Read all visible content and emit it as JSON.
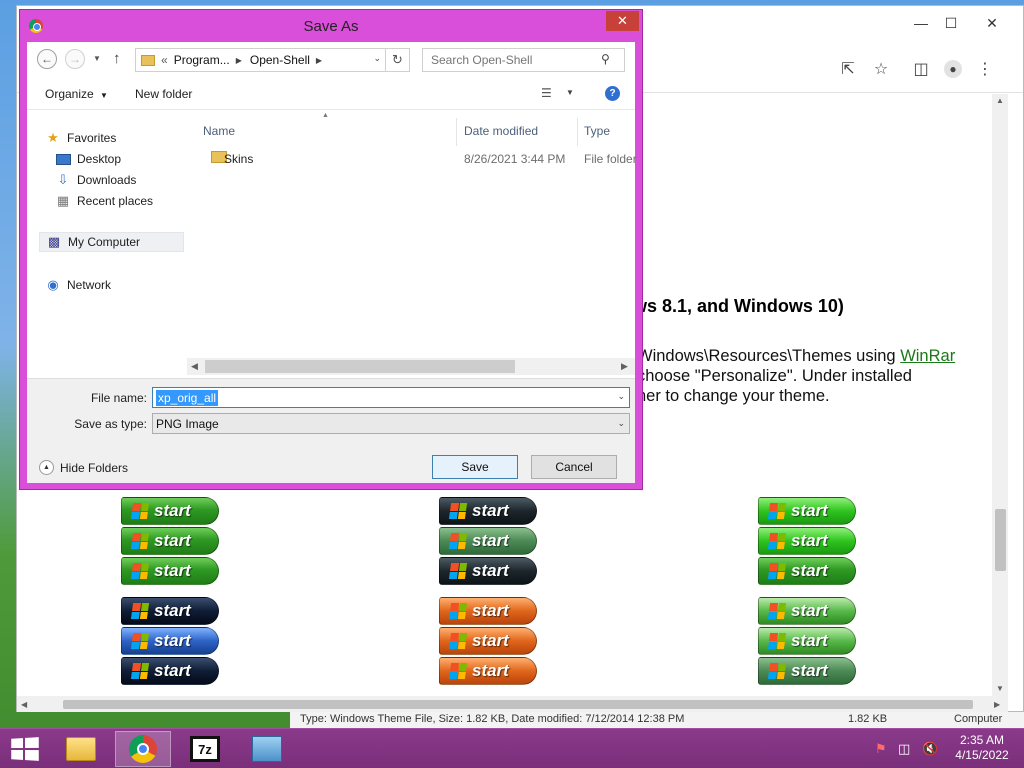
{
  "browser": {
    "page_heading": "ws 8.1, and Windows 10)",
    "line1_text": "Windows\\Resources\\Themes using ",
    "line1_link": "WinRar",
    "line2": "choose \"Personalize\".  Under installed",
    "line3": "ner to change your theme.",
    "start_label": "start"
  },
  "statusbar": {
    "text": "Type: Windows Theme File, Size: 1.82 KB, Date modified: 7/12/2014 12:38 PM",
    "size": "1.82 KB",
    "location": "Computer"
  },
  "dialog": {
    "title": "Save As",
    "address": {
      "crumb_prefix": "«",
      "segments": [
        "Program...",
        "Open-Shell"
      ]
    },
    "search_placeholder": "Search Open-Shell",
    "commands": {
      "organize": "Organize",
      "new_folder": "New folder"
    },
    "nav": {
      "favorites": "Favorites",
      "desktop": "Desktop",
      "downloads": "Downloads",
      "recent_places": "Recent places",
      "my_computer": "My Computer",
      "network": "Network"
    },
    "columns": {
      "name": "Name",
      "date_modified": "Date modified",
      "type": "Type"
    },
    "files": [
      {
        "name": "Skins",
        "date_modified": "8/26/2021 3:44 PM",
        "type": "File folder"
      }
    ],
    "file_name_label": "File name:",
    "file_name_value": "xp_orig_all",
    "save_as_type_label": "Save as type:",
    "save_as_type_value": "PNG Image",
    "hide_folders": "Hide Folders",
    "save_button": "Save",
    "cancel_button": "Cancel"
  },
  "taskbar": {
    "time": "2:35 AM",
    "date": "4/15/2022"
  }
}
